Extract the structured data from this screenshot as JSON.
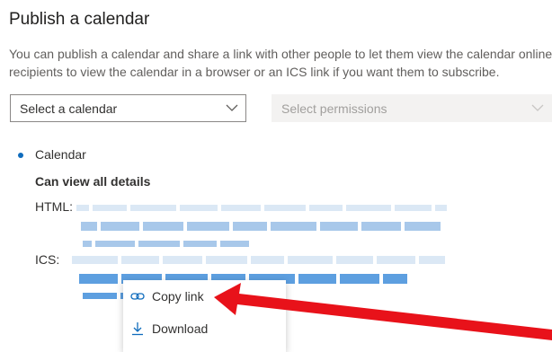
{
  "title": "Publish a calendar",
  "description": {
    "line1": "You can publish a calendar and share a link with other people to let them view the calendar online",
    "line2": "recipients to view the calendar in a browser or an ICS link if you want them to subscribe."
  },
  "calendar_select": {
    "value": "Select a calendar"
  },
  "permissions_select": {
    "value": "Select permissions"
  },
  "published": {
    "calendar_name": "Calendar",
    "permission": "Can view all details",
    "html_label": "HTML:",
    "ics_label": "ICS:"
  },
  "context_menu": {
    "items": [
      {
        "label": "Copy link",
        "icon": "link-icon"
      },
      {
        "label": "Download",
        "icon": "download-icon"
      }
    ]
  },
  "colors": {
    "accent": "#0f6cbd",
    "arrow": "#e8121a",
    "blur_light": "#dbe8f5",
    "blur_mid": "#a8c8ea",
    "blur_dark": "#5d9fe0"
  }
}
